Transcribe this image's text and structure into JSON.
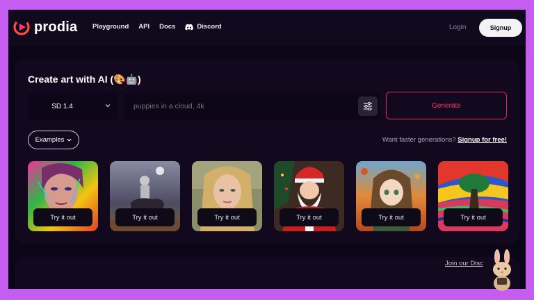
{
  "nav": {
    "logo_text": "prodia",
    "links": [
      {
        "label": "Playground"
      },
      {
        "label": "API"
      },
      {
        "label": "Docs"
      },
      {
        "label": "Discord",
        "icon": "discord-icon"
      }
    ],
    "login_label": "Login",
    "signup_label": "Signup"
  },
  "main": {
    "title": "Create art with AI (🎨🤖)",
    "model_select": "SD 1.4",
    "prompt_placeholder": "puppies in a cloud, 4k",
    "settings_icon": "sliders-icon",
    "generate_label": "Generate",
    "examples_label": "Examples",
    "faster_text": "Want faster generations?",
    "signup_free_label": "Signup for free!",
    "examples": [
      {
        "button": "Try it out",
        "theme": "colorful-portrait"
      },
      {
        "button": "Try it out",
        "theme": "astronaut-horse"
      },
      {
        "button": "Try it out",
        "theme": "blonde-woman"
      },
      {
        "button": "Try it out",
        "theme": "santa-claus"
      },
      {
        "button": "Try it out",
        "theme": "anime-girl-autumn"
      },
      {
        "button": "Try it out",
        "theme": "psychedelic-tree"
      }
    ]
  },
  "footer": {
    "join_label": "Join our Disc"
  },
  "colors": {
    "background": "#c45df0",
    "page": "#0b0518",
    "accent": "#e0245e"
  }
}
